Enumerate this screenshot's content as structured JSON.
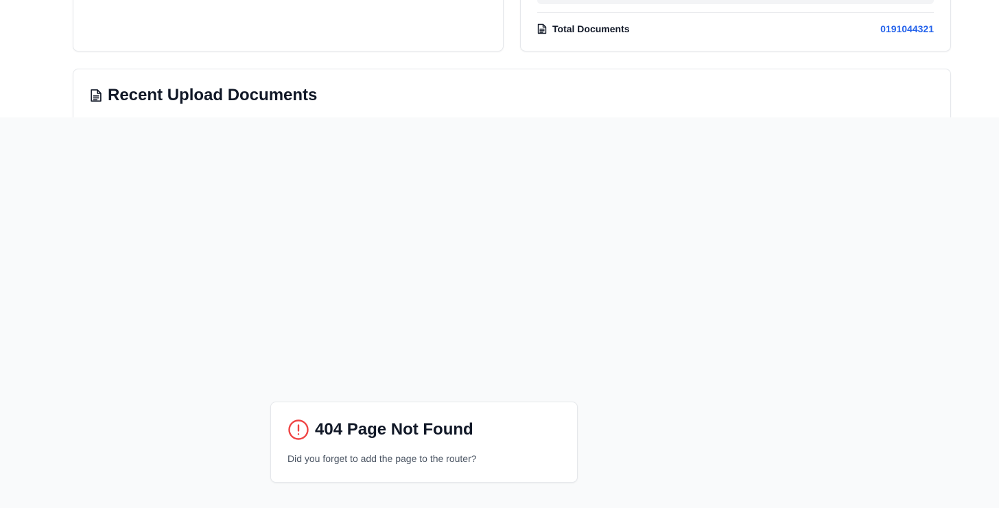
{
  "stats": {
    "total_documents_label": "Total Documents",
    "total_documents_value": "0191044321",
    "icon": "file-text-icon"
  },
  "recent": {
    "title": "Recent Upload Documents",
    "icon": "file-text-icon"
  },
  "not_found": {
    "title": "404 Page Not Found",
    "message": "Did you forget to add the page to the router?",
    "icon": "alert-circle-icon",
    "icon_color": "#ef4444"
  },
  "colors": {
    "accent": "#2563eb",
    "overlay_bg": "#f9fafb",
    "border": "#e5e7eb"
  }
}
